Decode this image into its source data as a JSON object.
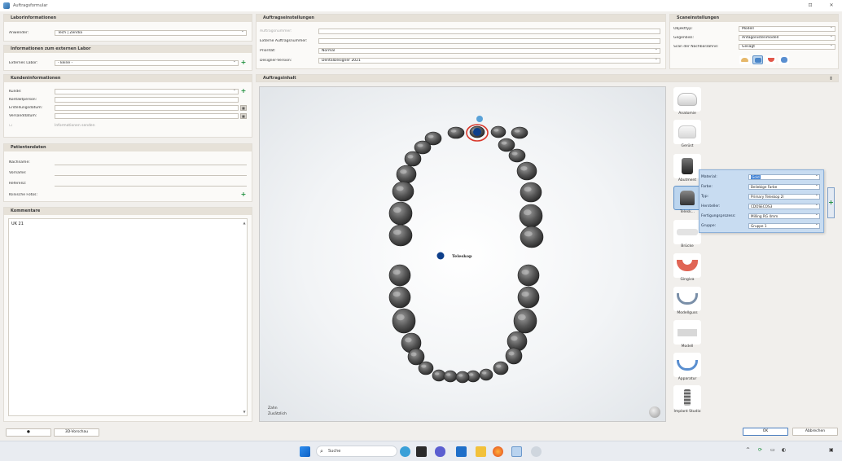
{
  "window": {
    "title": "Auftragsformular",
    "controls": [
      "⊡",
      "✕"
    ]
  },
  "lab_info": {
    "header": "Laborinformationen",
    "operator_label": "Anwender:",
    "operator_value": "Tech | Zendia"
  },
  "external_lab": {
    "header": "Informationen zum externen Labor",
    "lab_label": "Externes Labor:",
    "lab_value": "- keine -"
  },
  "customer": {
    "header": "Kundeninformationen",
    "customer_label": "Kunde:",
    "contact_label": "Kontaktperson:",
    "created_label": "Erstellungsdatum:",
    "ship_label": "Versanddatum:",
    "refer_label": "Informationen senden"
  },
  "patient": {
    "header": "Patientendaten",
    "lastname_label": "Nachname:",
    "firstname_label": "Vorname:",
    "reference_label": "Referenz:",
    "photos_label": "Klinische Fotos:"
  },
  "comments": {
    "header": "Kommentare",
    "text": "UK 21"
  },
  "order_settings": {
    "header": "Auftragseinstellungen",
    "order_number_label": "Auftragsnummer:",
    "ext_order_label": "Externe Auftragsnummer:",
    "priority_label": "Priorität:",
    "priority_value": "Normal",
    "designer_label": "Designer-Version:",
    "designer_value": "DentalDesigner 2021"
  },
  "scan_settings": {
    "header": "Scaneinstellungen",
    "object_label": "Objekttyp:",
    "object_value": "Modell",
    "antagonist_label": "Gegenbiss:",
    "antagonist_value": "Antagonistenmodell",
    "scan_label": "Scan der Nachbarzähne:",
    "scan_value": "Gesägt"
  },
  "order_content": {
    "header": "Auftragsinhalt"
  },
  "viewport": {
    "tooth_label": "Teleskop",
    "legend_lines": [
      "Zahn",
      "Zusätzlich"
    ]
  },
  "tools": [
    {
      "name": "anatomie",
      "label": "Anatomie"
    },
    {
      "name": "gerust",
      "label": "Gerüst"
    },
    {
      "name": "abutment",
      "label": "Abutment"
    },
    {
      "name": "teleskop",
      "label": "Telesk..."
    },
    {
      "name": "brucke",
      "label": "Brücke"
    },
    {
      "name": "gingiva",
      "label": "Gingiva"
    },
    {
      "name": "modellguss",
      "label": "Modellguss"
    },
    {
      "name": "modell",
      "label": "Modell"
    },
    {
      "name": "apparatur",
      "label": "Apparatur"
    },
    {
      "name": "implant-studio",
      "label": "Implant Studio"
    }
  ],
  "popup": {
    "rows": [
      {
        "label": "Material:",
        "value": "Gold"
      },
      {
        "label": "Farbe:",
        "value": "Beliebige Farbe"
      },
      {
        "label": "Typ:",
        "value": "Primary Teleskop 2l"
      },
      {
        "label": "Hersteller:",
        "value": "CDOSECOS3"
      },
      {
        "label": "Fertigungsprozess:",
        "value": "Milling RG 4mm"
      },
      {
        "label": "Gruppe:",
        "value": "Gruppe 1"
      }
    ]
  },
  "bottom": {
    "preview_label": "3D-Vorschau",
    "ok_label": "OK",
    "cancel_label": "Abbrechen"
  },
  "taskbar": {
    "search_placeholder": "Suche"
  },
  "colors": {
    "accent": "#3d7fd3",
    "add_green": "#1b8d3a",
    "selection_ring": "#d9372a"
  }
}
